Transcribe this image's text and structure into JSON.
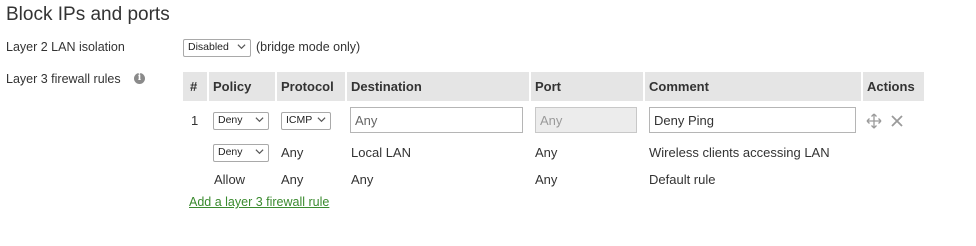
{
  "section": {
    "title": "Block IPs and ports"
  },
  "lan_isolation": {
    "label": "Layer 2 LAN isolation",
    "value": "Disabled",
    "note": "(bridge mode only)"
  },
  "firewall": {
    "label": "Layer 3 firewall rules",
    "info_icon": "info-icon",
    "headers": {
      "num": "#",
      "policy": "Policy",
      "protocol": "Protocol",
      "destination": "Destination",
      "port": "Port",
      "comment": "Comment",
      "actions": "Actions"
    },
    "rows": [
      {
        "num": "1",
        "policy": "Deny",
        "protocol": "ICMP",
        "destination": "Any",
        "port": "Any",
        "comment": "Deny Ping",
        "actions": [
          "move-icon",
          "close-icon"
        ]
      },
      {
        "policy": "Deny",
        "protocol": "Any",
        "destination": "Local LAN",
        "port": "Any",
        "comment": "Wireless clients accessing LAN"
      },
      {
        "policy": "Allow",
        "protocol": "Any",
        "destination": "Any",
        "port": "Any",
        "comment": "Default rule"
      }
    ],
    "add_link": "Add a layer 3 firewall rule"
  },
  "colors": {
    "header_bg": "#e5e5e5",
    "link": "#3a8a2e",
    "icon_gray": "#9a9a9a"
  }
}
